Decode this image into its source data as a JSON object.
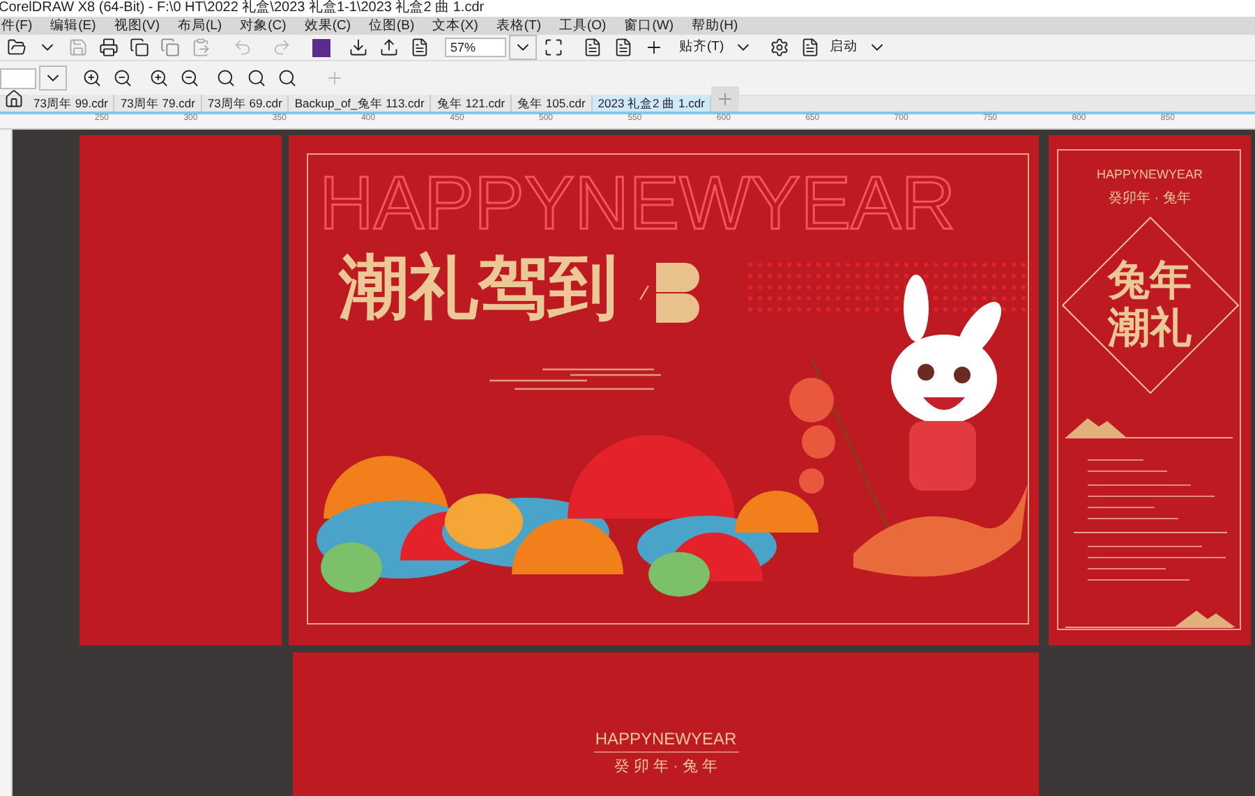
{
  "window": {
    "title": "CorelDRAW X8 (64-Bit) - F:\\0 HT\\2022 礼盒\\2023 礼盒1-1\\2023 礼盒2 曲 1.cdr"
  },
  "menu": [
    "件(F)",
    "编辑(E)",
    "视图(V)",
    "布局(L)",
    "对象(C)",
    "效果(C)",
    "位图(B)",
    "文本(X)",
    "表格(T)",
    "工具(O)",
    "窗口(W)",
    "帮助(H)"
  ],
  "toolbar": {
    "zoom": "57%",
    "snap": "贴齐(T)",
    "launch": "启动"
  },
  "tabs": [
    {
      "label": "73周年 99.cdr",
      "selected": false
    },
    {
      "label": "73周年 79.cdr",
      "selected": false
    },
    {
      "label": "73周年 69.cdr",
      "selected": false
    },
    {
      "label": "Backup_of_兔年 113.cdr",
      "selected": false
    },
    {
      "label": "兔年 121.cdr",
      "selected": false
    },
    {
      "label": "兔年 105.cdr",
      "selected": false
    },
    {
      "label": "2023 礼盒2 曲 1.cdr",
      "selected": true
    }
  ],
  "ruler": [
    "250",
    "300",
    "350",
    "400",
    "450",
    "500",
    "550",
    "600",
    "650",
    "700",
    "750",
    "800",
    "850"
  ],
  "main_page": {
    "outline_title": "HAPPYNEWYEAR",
    "headline": "潮礼驾到"
  },
  "side_page": {
    "title": "HAPPYNEWYEAR",
    "subtitle": "癸卯年 · 兔年",
    "headline_lines": [
      "兔年",
      "潮礼"
    ]
  },
  "bottom_page": {
    "title": "HAPPYNEWYEAR",
    "subtitle": "癸 卯 年 · 兔 年"
  }
}
